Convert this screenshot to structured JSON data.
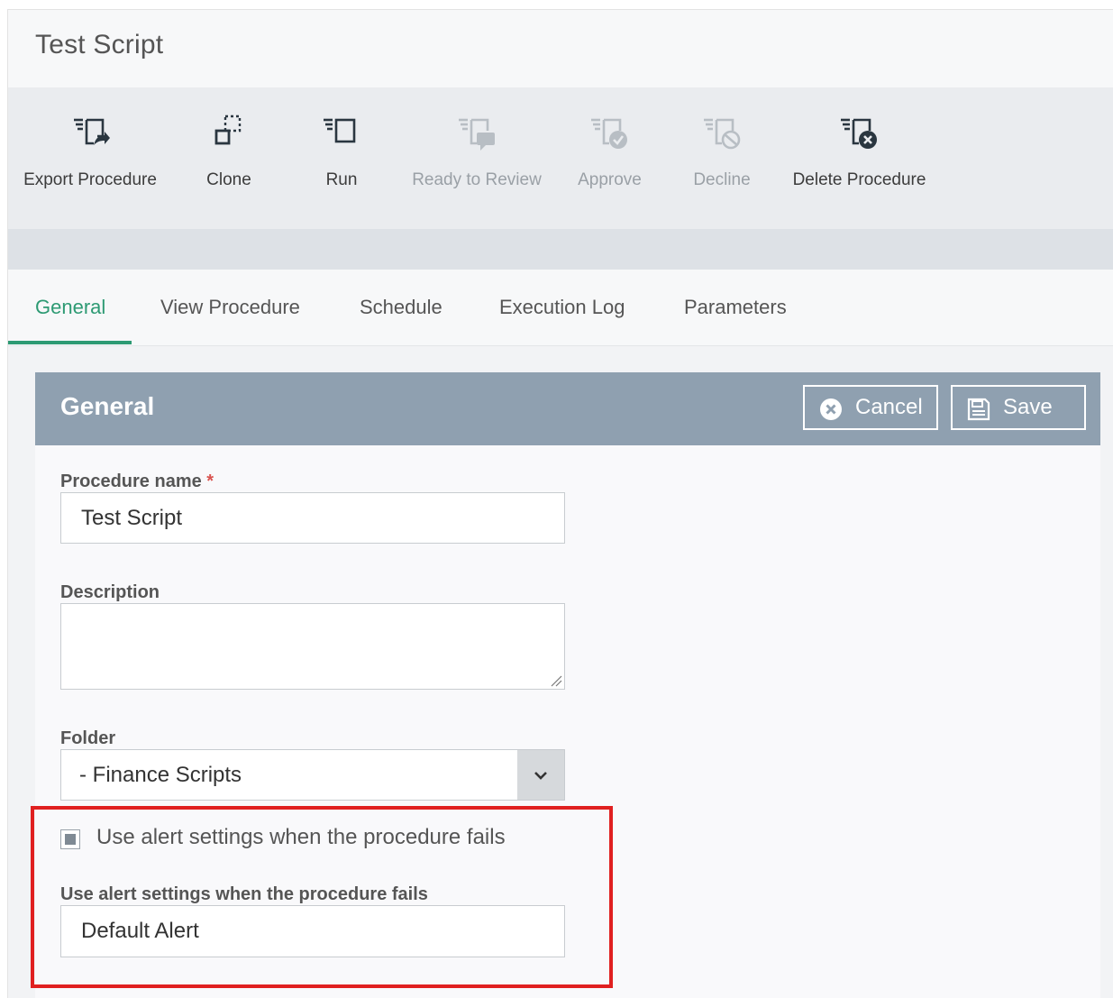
{
  "page": {
    "title": "Test Script"
  },
  "toolbar": {
    "buttons": [
      {
        "label": "Export Procedure",
        "icon": "export-procedure-icon",
        "enabled": true
      },
      {
        "label": "Clone",
        "icon": "clone-icon",
        "enabled": true
      },
      {
        "label": "Run",
        "icon": "run-icon",
        "enabled": true
      },
      {
        "label": "Ready to Review",
        "icon": "ready-to-review-icon",
        "enabled": false
      },
      {
        "label": "Approve",
        "icon": "approve-icon",
        "enabled": false
      },
      {
        "label": "Decline",
        "icon": "decline-icon",
        "enabled": false
      },
      {
        "label": "Delete Procedure",
        "icon": "delete-procedure-icon",
        "enabled": true
      }
    ]
  },
  "tabs": [
    {
      "label": "General",
      "active": true
    },
    {
      "label": "View Procedure",
      "active": false
    },
    {
      "label": "Schedule",
      "active": false
    },
    {
      "label": "Execution Log",
      "active": false
    },
    {
      "label": "Parameters",
      "active": false
    }
  ],
  "panel": {
    "title": "General",
    "cancel_label": "Cancel",
    "save_label": "Save"
  },
  "form": {
    "procedure_name": {
      "label": "Procedure name",
      "required_mark": "*",
      "value": "Test Script"
    },
    "description": {
      "label": "Description",
      "value": ""
    },
    "folder": {
      "label": "Folder",
      "value": "- Finance Scripts"
    },
    "alert_checkbox": {
      "label": "Use alert settings when the procedure fails",
      "checked": true
    },
    "alert_field": {
      "label": "Use alert settings when the procedure fails",
      "value": "Default Alert"
    }
  },
  "colors": {
    "accent": "#2d9a73",
    "panel_header": "#8fa0b0",
    "highlight": "#e02020"
  }
}
